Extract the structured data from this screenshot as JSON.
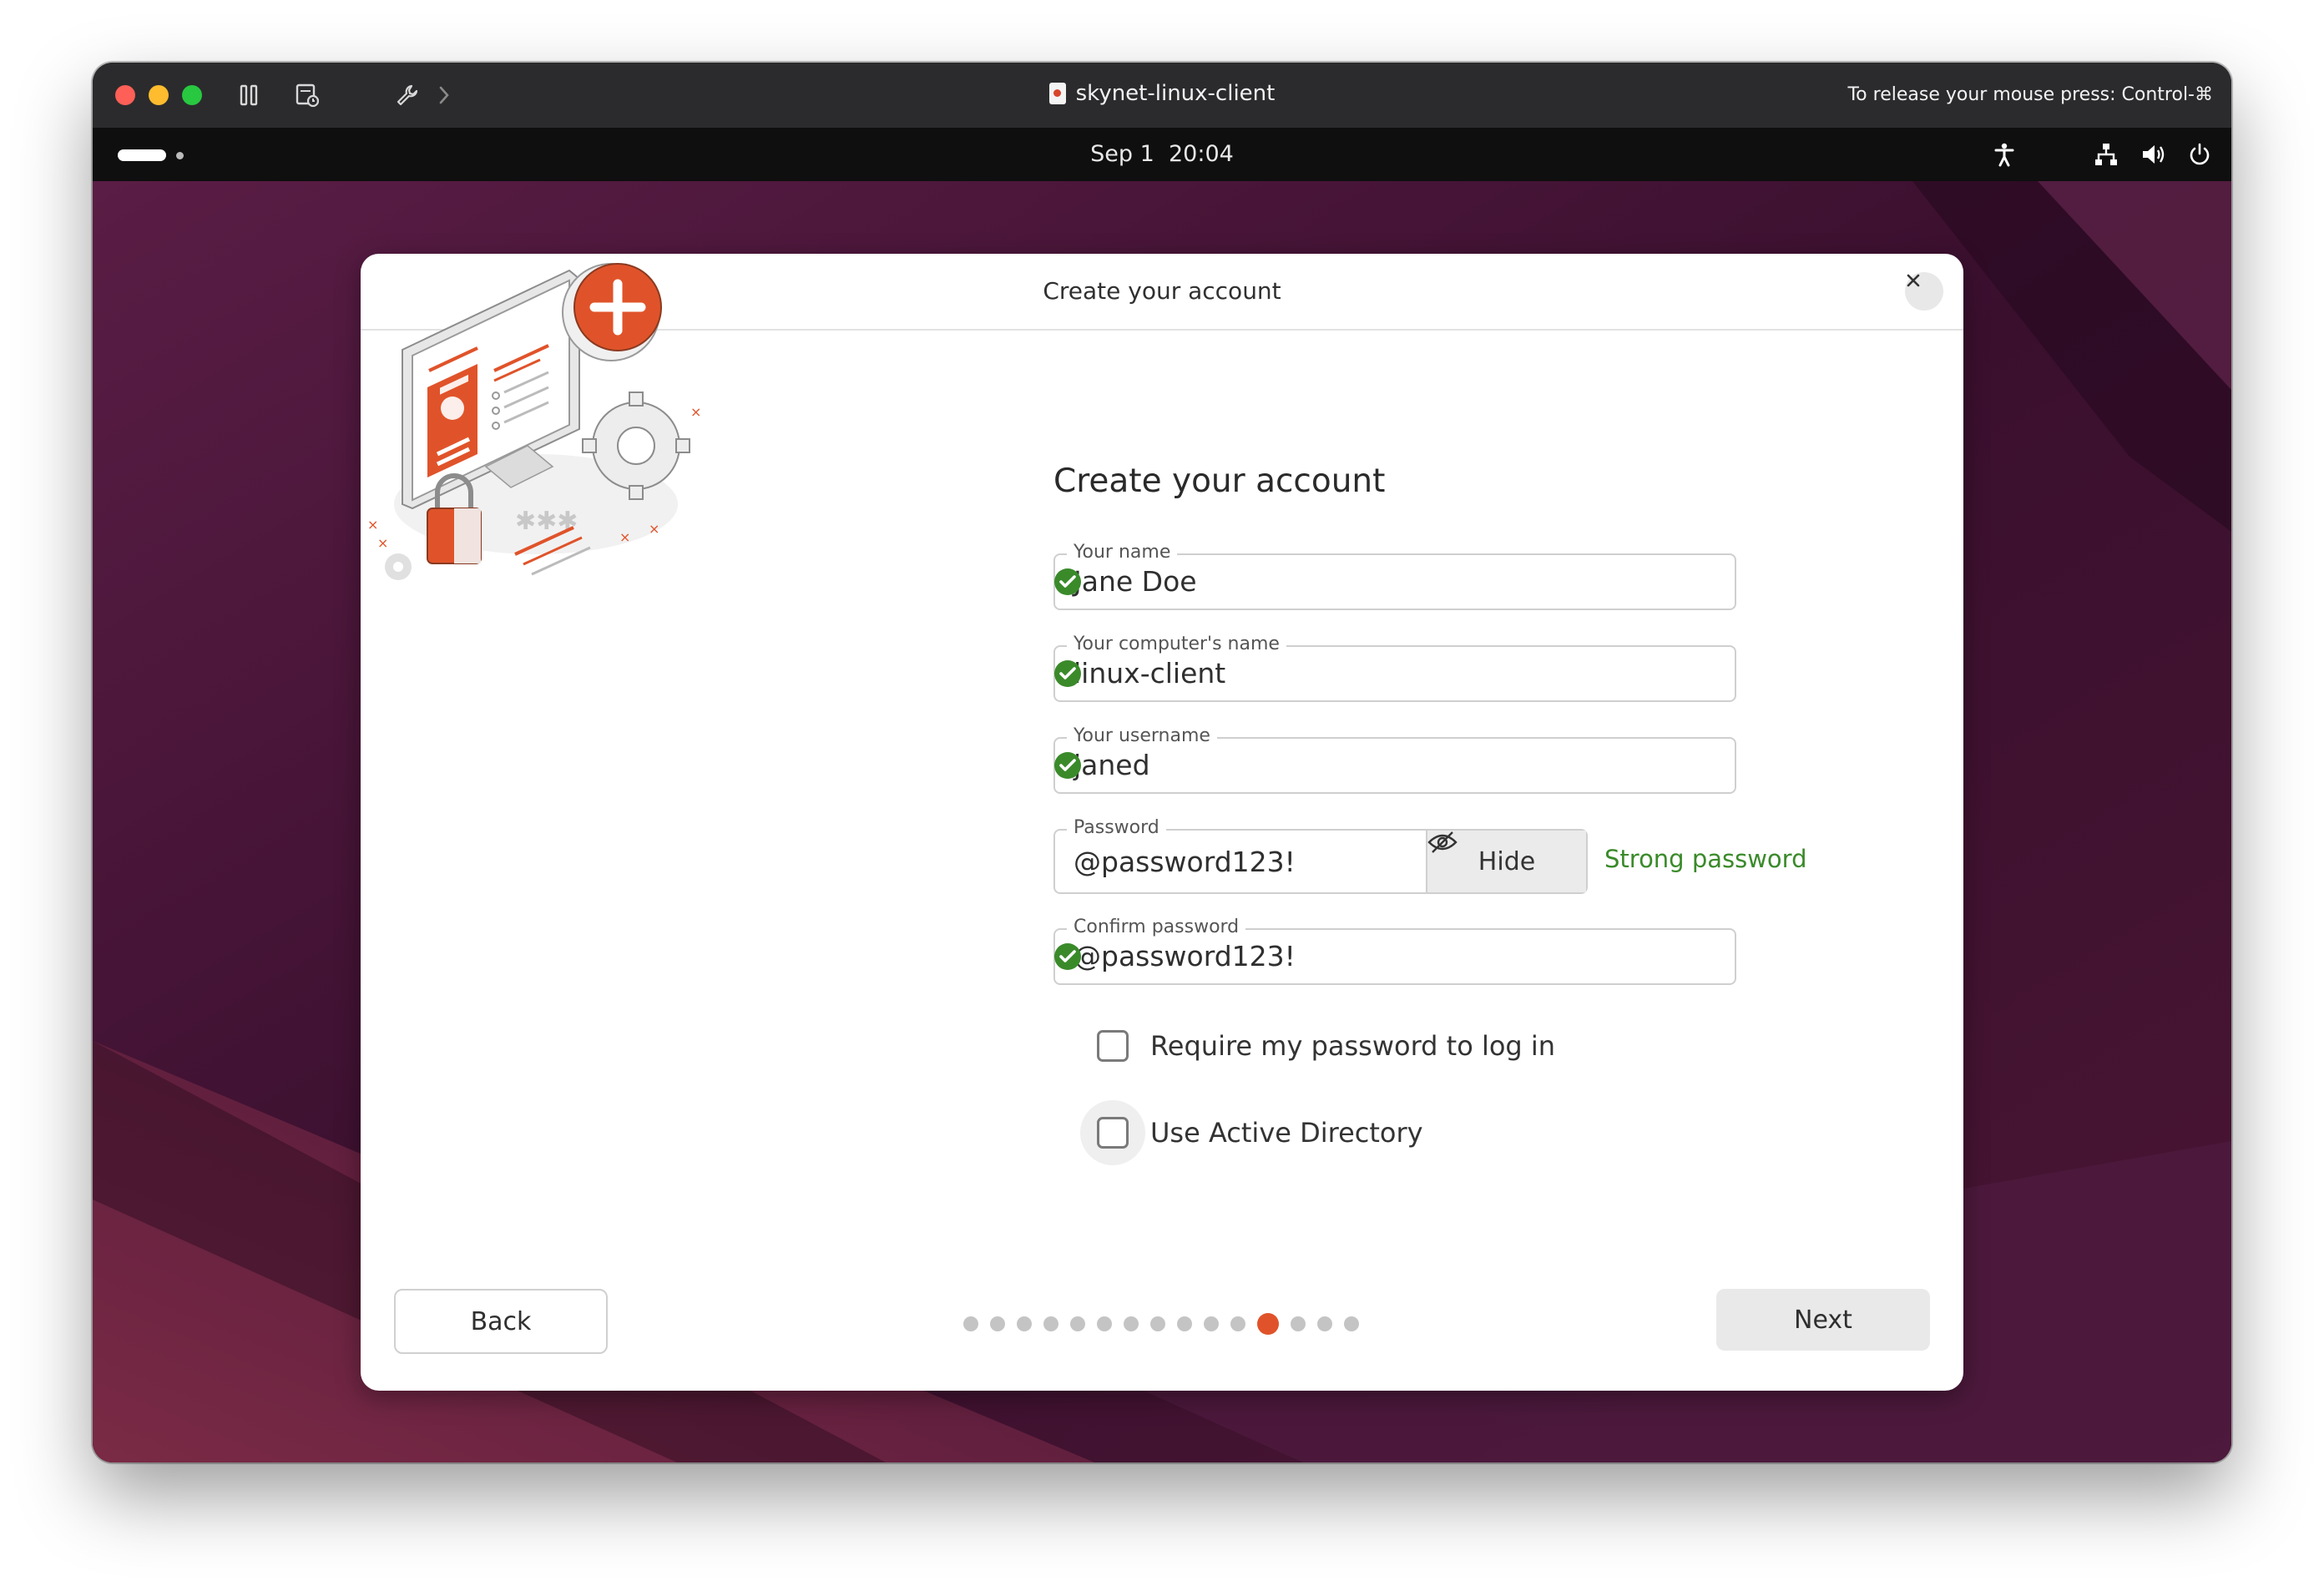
{
  "window": {
    "title": "skynet-linux-client",
    "release_hint": "To release your mouse press: Control-⌘",
    "toolbar_icons": [
      "pause-icon",
      "snapshot-icon",
      "wrench-icon",
      "chevron-right-icon"
    ]
  },
  "top_panel": {
    "date": "Sep 1",
    "time": "20:04",
    "tray_icons": [
      "accessibility-icon",
      "network-icon",
      "volume-icon",
      "power-icon"
    ]
  },
  "dialog": {
    "header_title": "Create your account",
    "heading": "Create your account",
    "fields": {
      "name": {
        "label": "Your name",
        "value": "Jane Doe",
        "valid": true
      },
      "computer": {
        "label": "Your computer's name",
        "value": "linux-client",
        "valid": true
      },
      "username": {
        "label": "Your username",
        "value": "janed",
        "valid": true
      },
      "password": {
        "label": "Password",
        "value": "@password123!",
        "toggle_label": "Hide",
        "strength": "Strong password"
      },
      "confirm": {
        "label": "Confirm password",
        "value": "@password123!",
        "valid": true
      }
    },
    "options": {
      "require_password": {
        "label": "Require my password to log in",
        "checked": false
      },
      "active_directory": {
        "label": "Use Active Directory",
        "checked": false
      }
    },
    "back_label": "Back",
    "next_label": "Next",
    "progress": {
      "total_steps": 15,
      "current_step": 12
    }
  },
  "colors": {
    "accent": "#e0532a",
    "valid_green": "#3a8a2a",
    "desktop_purple": "#3b1030"
  }
}
